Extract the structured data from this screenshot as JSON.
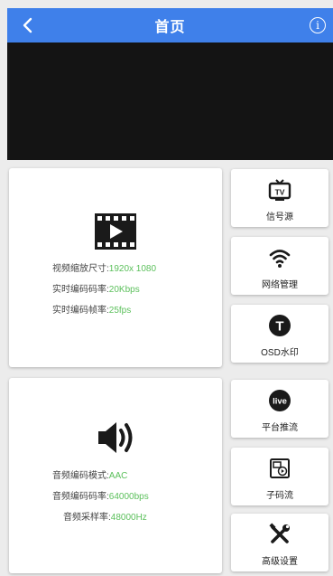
{
  "header": {
    "title": "首页",
    "back_icon": "chevron-left-icon",
    "info_glyph": "i"
  },
  "video_info": {
    "scale_label": "视频缩放尺寸:",
    "scale_value": "1920x 1080",
    "bitrate_label": "实时编码码率:",
    "bitrate_value": "20Kbps",
    "framerate_label": "实时编码帧率:",
    "framerate_value": "25fps"
  },
  "audio_info": {
    "mode_label": "音频编码模式:",
    "mode_value": "AAC",
    "bitrate_label": "音频编码码率:",
    "bitrate_value": "64000bps",
    "samplerate_label": "音频采样率:",
    "samplerate_value": "48000Hz"
  },
  "menu": {
    "signal_source": "信号源",
    "network": "网络管理",
    "osd": "OSD水印",
    "platform_push": "平台推流",
    "substream": "子码流",
    "advanced": "高级设置"
  },
  "icon_text": {
    "tv": "TV",
    "live": "live",
    "osd_t": "T"
  },
  "colors": {
    "header": "#3f80ea",
    "value_green": "#5cc05c",
    "video_bg": "#141414"
  }
}
